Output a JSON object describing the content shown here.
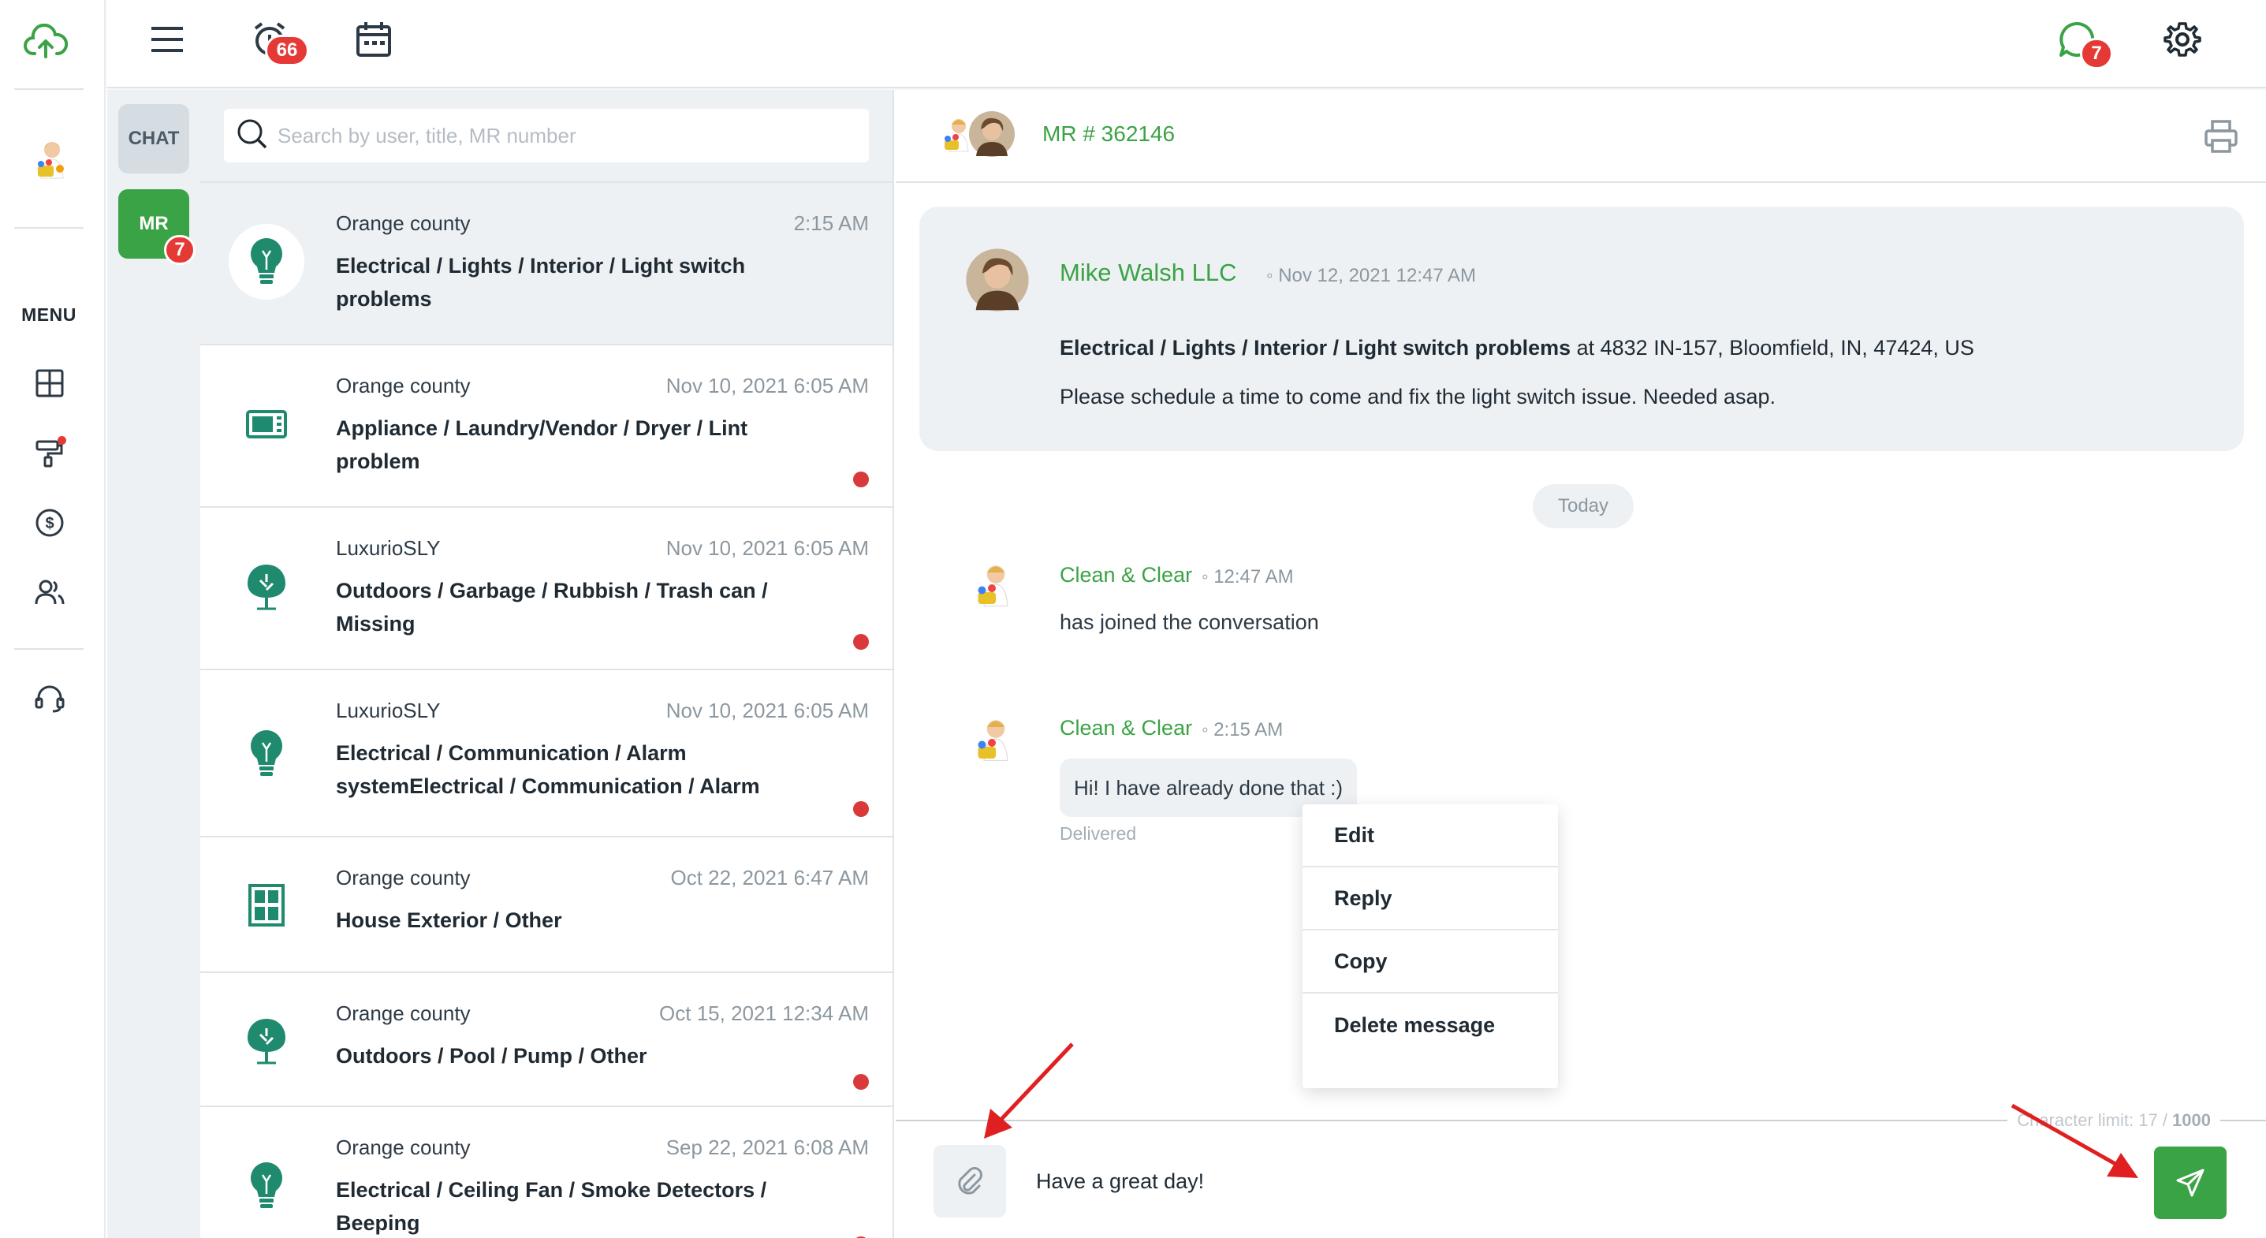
{
  "colors": {
    "accent": "#3aa345",
    "badge": "#e53935",
    "unread": "#d9393a",
    "icon_teal": "#1f8a6e"
  },
  "rail": {
    "menu_label": "MENU",
    "nav": [
      "dashboard-icon",
      "paint-roller-icon",
      "dollar-icon",
      "users-icon",
      "headset-icon"
    ]
  },
  "topbar": {
    "notifications_count": "66",
    "messages_count": "7"
  },
  "modes": {
    "chat_label": "CHAT",
    "mr_label": "MR",
    "mr_count": "7"
  },
  "search": {
    "placeholder": "Search by user, title, MR number"
  },
  "conversations": [
    {
      "location": "Orange county",
      "time": "2:15 AM",
      "title": "Electrical / Lights / Interior / Light switch problems",
      "icon": "lightbulb-icon",
      "unread": false
    },
    {
      "location": "Orange county",
      "time": "Nov 10, 2021 6:05 AM",
      "title": "Appliance / Laundry/Vendor / Dryer / Lint problem",
      "icon": "appliance-icon",
      "unread": true
    },
    {
      "location": "LuxurioSLY",
      "time": "Nov 10, 2021 6:05 AM",
      "title": "Outdoors / Garbage / Rubbish / Trash can / Missing",
      "icon": "tree-icon",
      "unread": true
    },
    {
      "location": "LuxurioSLY",
      "time": "Nov 10, 2021 6:05 AM",
      "title": "Electrical / Communication / Alarm systemElectrical / Communication / Alarm",
      "icon": "lightbulb-icon",
      "unread": true
    },
    {
      "location": "Orange county",
      "time": "Oct 22, 2021 6:47 AM",
      "title": "House Exterior / Other",
      "icon": "window-icon",
      "unread": false
    },
    {
      "location": "Orange county",
      "time": "Oct 15, 2021 12:34 AM",
      "title": "Outdoors / Pool / Pump / Other",
      "icon": "tree-icon",
      "unread": true
    },
    {
      "location": "Orange county",
      "time": "Sep 22, 2021 6:08 AM",
      "title": "Electrical / Ceiling Fan / Smoke Detectors / Beeping",
      "icon": "lightbulb-icon",
      "unread": true
    }
  ],
  "chat": {
    "mr_number": "MR # 362146",
    "request": {
      "author": "Mike Walsh LLC",
      "date": "Nov 12, 2021 12:47 AM",
      "category": "Electrical / Lights / Interior / Light switch problems",
      "address": " at 4832 IN-157, Bloomfield, IN, 47424, US",
      "body": "Please schedule a time to come and fix the light switch issue. Needed asap."
    },
    "day_separator": "Today",
    "messages": [
      {
        "author": "Clean & Clear",
        "time": "12:47 AM",
        "text": "has joined the conversation"
      },
      {
        "author": "Clean & Clear",
        "time": "2:15 AM",
        "text": "Hi! I have already done that :)",
        "status": "Delivered"
      }
    ],
    "context_menu": [
      "Edit",
      "Reply",
      "Copy",
      "Delete message"
    ],
    "composer": {
      "value": "Have a great day!",
      "char_limit_prefix": "Character limit: 17 / ",
      "char_limit_max": "1000"
    }
  }
}
